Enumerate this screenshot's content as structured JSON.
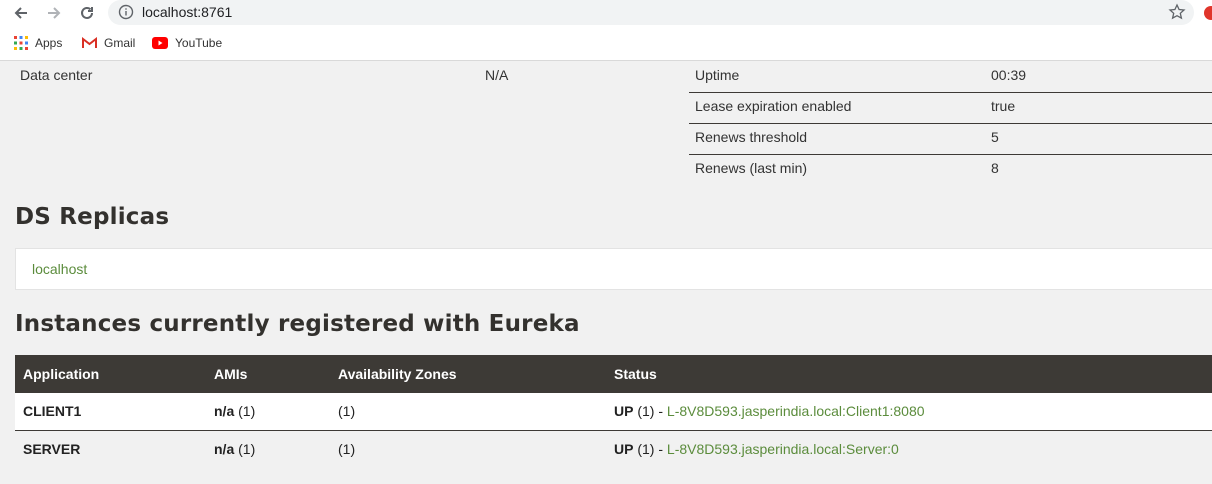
{
  "browser": {
    "url": "localhost:8761",
    "bookmarks": [
      {
        "label": "Apps",
        "icon": "apps-grid-icon"
      },
      {
        "label": "Gmail",
        "icon": "gmail-icon"
      },
      {
        "label": "YouTube",
        "icon": "youtube-icon"
      }
    ]
  },
  "general": {
    "data_center_label": "Data center",
    "data_center_value": "N/A"
  },
  "stats": [
    {
      "label": "Uptime",
      "value": "00:39"
    },
    {
      "label": "Lease expiration enabled",
      "value": "true"
    },
    {
      "label": "Renews threshold",
      "value": "5"
    },
    {
      "label": "Renews (last min)",
      "value": "8"
    }
  ],
  "replicas": {
    "title": "DS Replicas",
    "host": "localhost"
  },
  "instances": {
    "title": "Instances currently registered with Eureka",
    "headers": [
      "Application",
      "AMIs",
      "Availability Zones",
      "Status"
    ],
    "rows": [
      {
        "app": "CLIENT1",
        "ami_bold": "n/a",
        "ami_count": "(1)",
        "zones": "(1)",
        "status": "UP",
        "status_count": "(1) -",
        "instance": "L-8V8D593.jasperindia.local:Client1:8080"
      },
      {
        "app": "SERVER",
        "ami_bold": "n/a",
        "ami_count": "(1)",
        "zones": "(1)",
        "status": "UP",
        "status_count": "(1) -",
        "instance": "L-8V8D593.jasperindia.local:Server:0"
      }
    ]
  },
  "colors": {
    "header_dark": "#3d3a36",
    "link_green": "#5b8c3c",
    "page_bg": "#f1f1f1"
  }
}
